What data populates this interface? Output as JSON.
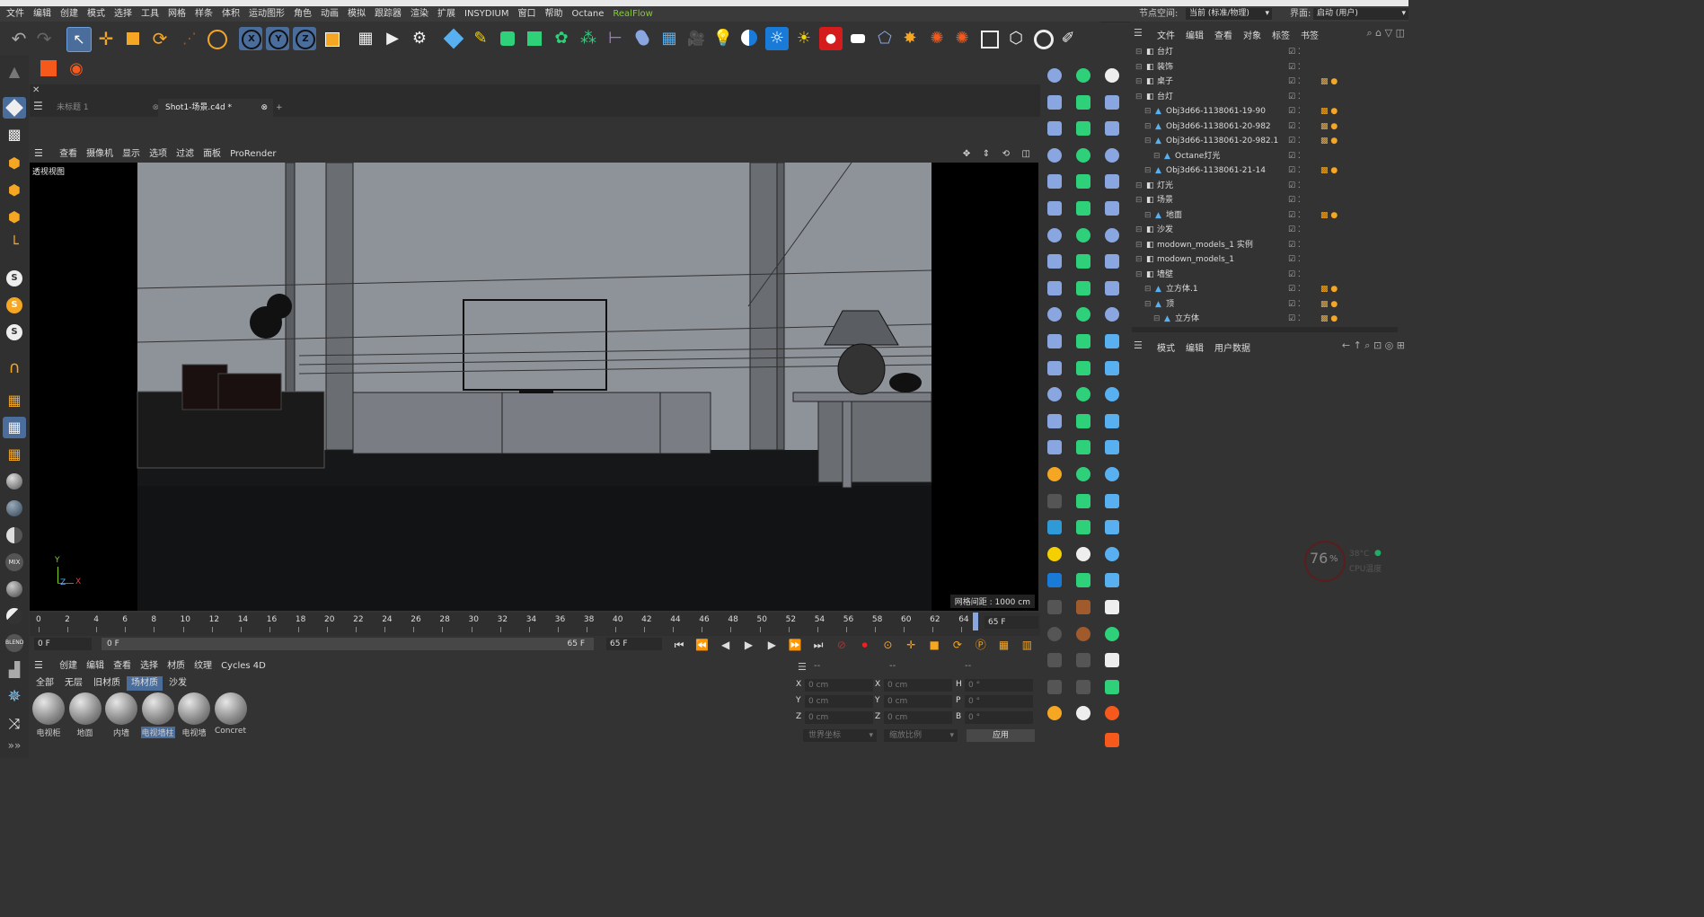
{
  "menubar": {
    "items": [
      "文件",
      "编辑",
      "创建",
      "模式",
      "选择",
      "工具",
      "网格",
      "样条",
      "体积",
      "运动图形",
      "角色",
      "动画",
      "模拟",
      "跟踪器",
      "渲染",
      "扩展",
      "INSYDIUM",
      "窗口",
      "帮助",
      "Octane",
      "RealFlow"
    ],
    "node_space_label": "节点空间:",
    "node_space_value": "当前 (标准/物理)",
    "layout_label": "界面:",
    "layout_value": "启动 (用户)"
  },
  "tabs": [
    {
      "label": "未标题 1",
      "close": "⊗"
    },
    {
      "label": "Shot1-场景.c4d *",
      "close": "⊗"
    }
  ],
  "tab_add": "+",
  "viewport": {
    "menu": [
      "查看",
      "摄像机",
      "显示",
      "选项",
      "过滤",
      "面板",
      "ProRender"
    ],
    "label": "透视视图",
    "grid_info": "网格间距 : 1000 cm",
    "axis_y": "Y",
    "axis_z": "Z",
    "axis_x": "X"
  },
  "timeline": {
    "ticks": [
      "0",
      "2",
      "4",
      "6",
      "8",
      "10",
      "12",
      "14",
      "16",
      "18",
      "20",
      "22",
      "24",
      "26",
      "28",
      "30",
      "32",
      "34",
      "36",
      "38",
      "40",
      "42",
      "44",
      "46",
      "48",
      "50",
      "52",
      "54",
      "56",
      "58",
      "60",
      "62",
      "64"
    ],
    "end_frame": "65 F"
  },
  "playbar": {
    "start": "0 F",
    "current": "0 F",
    "range_end": "65 F",
    "max": "65 F"
  },
  "materials": {
    "menu": [
      "创建",
      "编辑",
      "查看",
      "选择",
      "材质",
      "纹理",
      "Cycles 4D"
    ],
    "filter_tabs": [
      "全部",
      "无层",
      "旧材质",
      "场材质",
      "沙发"
    ],
    "active_filter": 3,
    "items": [
      "电视柜",
      "地面",
      "内墙",
      "电视墙柱",
      "电视墙",
      "Concret"
    ]
  },
  "coordinates": {
    "header": [
      "--",
      "--",
      "--"
    ],
    "rows": [
      {
        "a": "X",
        "av": "0 cm",
        "b": "X",
        "bv": "0 cm",
        "c": "H",
        "cv": "0 °"
      },
      {
        "a": "Y",
        "av": "0 cm",
        "b": "Y",
        "bv": "0 cm",
        "c": "P",
        "cv": "0 °"
      },
      {
        "a": "Z",
        "av": "0 cm",
        "b": "Z",
        "bv": "0 cm",
        "c": "B",
        "cv": "0 °"
      }
    ],
    "mode1": "世界坐标",
    "mode2": "缩放比例",
    "apply": "应用"
  },
  "object_manager": {
    "menu": [
      "文件",
      "编辑",
      "查看",
      "对象",
      "标签",
      "书签"
    ],
    "objects": [
      {
        "name": "台灯",
        "indent": 0
      },
      {
        "name": "装饰",
        "indent": 0
      },
      {
        "name": "桌子",
        "indent": 0
      },
      {
        "name": "台灯",
        "indent": 0
      },
      {
        "name": "Obj3d66-1138061-19-90",
        "indent": 1
      },
      {
        "name": "Obj3d66-1138061-20-982",
        "indent": 1
      },
      {
        "name": "Obj3d66-1138061-20-982.1",
        "indent": 1
      },
      {
        "name": "Octane灯光",
        "indent": 2
      },
      {
        "name": "Obj3d66-1138061-21-14",
        "indent": 1
      },
      {
        "name": "灯光",
        "indent": 0
      },
      {
        "name": "场景",
        "indent": 0
      },
      {
        "name": "地面",
        "indent": 1
      },
      {
        "name": "沙发",
        "indent": 0
      },
      {
        "name": "modown_models_1 实例",
        "indent": 0
      },
      {
        "name": "modown_models_1",
        "indent": 0
      },
      {
        "name": "墙壁",
        "indent": 0
      },
      {
        "name": "立方体.1",
        "indent": 1
      },
      {
        "name": "顶",
        "indent": 1
      },
      {
        "name": "立方体",
        "indent": 2
      }
    ]
  },
  "attributes": {
    "menu": [
      "模式",
      "编辑",
      "用户数据"
    ]
  },
  "cpu": {
    "percent": "76",
    "unit": "%",
    "temp": "38°C",
    "label": "CPU温度"
  }
}
